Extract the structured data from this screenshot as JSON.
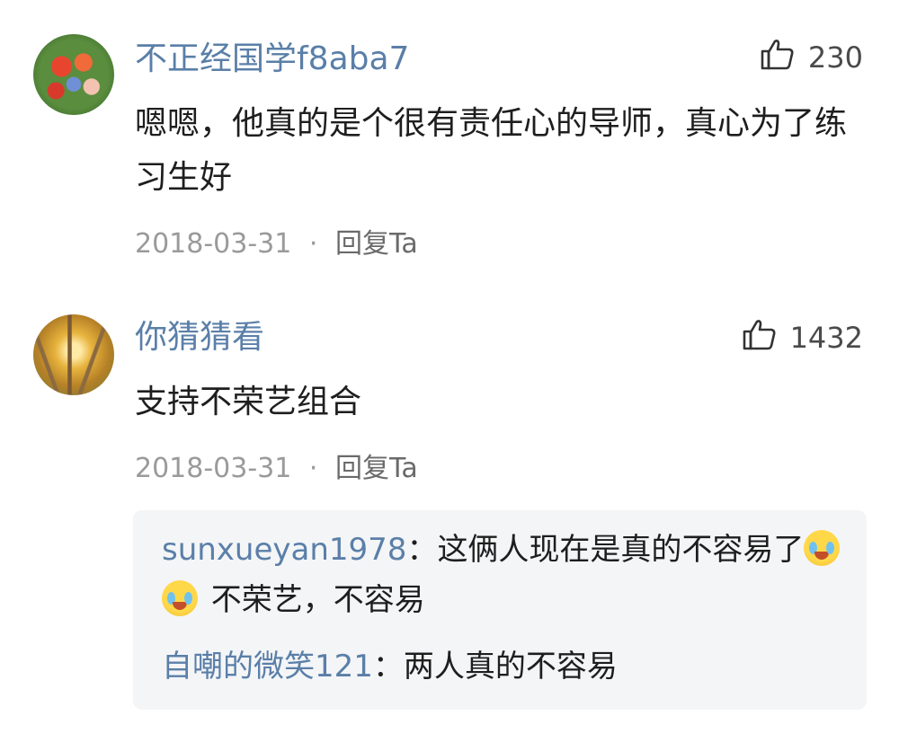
{
  "comments": [
    {
      "username": "不正经国学f8aba7",
      "likes": "230",
      "text": "嗯嗯，他真的是个很有责任心的导师，真心为了练习生好",
      "date": "2018-03-31",
      "separator": "·",
      "reply_label": "回复Ta"
    },
    {
      "username": "你猜猜看",
      "likes": "1432",
      "text": "支持不荣艺组合",
      "date": "2018-03-31",
      "separator": "·",
      "reply_label": "回复Ta"
    }
  ],
  "replies": [
    {
      "name": "sunxueyan1978",
      "colon": "：",
      "text_before": "这俩人现在是真的不容易了",
      "emoji": "crying-laughing-emoji",
      "text_after": " 不荣艺，不容易"
    },
    {
      "name": "自嘲的微笑121",
      "colon": "：",
      "text": "两人真的不容易"
    }
  ],
  "icons": {
    "like": "thumbs-up-icon"
  },
  "colors": {
    "username": "#5a7fa8",
    "meta": "#9a9a9a",
    "reply_bg": "#f4f5f7"
  }
}
